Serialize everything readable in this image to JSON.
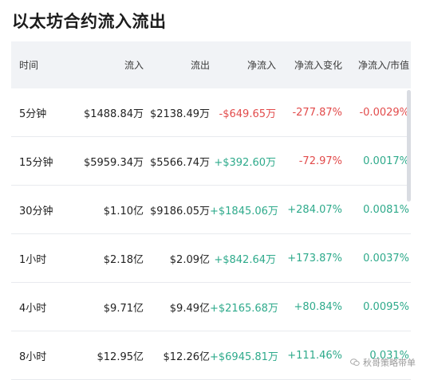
{
  "title": "以太坊合约流入流出",
  "columns": [
    "时间",
    "流入",
    "流出",
    "净流入",
    "净流入变化",
    "净流入/市值"
  ],
  "rows": [
    {
      "time": "5分钟",
      "inflow": "$1488.84万",
      "outflow": "$2138.49万",
      "net": "-$649.65万",
      "change": "-277.87%",
      "ratio": "-0.0029%",
      "net_dir": "neg",
      "change_dir": "neg",
      "ratio_dir": "neg"
    },
    {
      "time": "15分钟",
      "inflow": "$5959.34万",
      "outflow": "$5566.74万",
      "net": "+$392.60万",
      "change": "-72.97%",
      "ratio": "0.0017%",
      "net_dir": "pos",
      "change_dir": "neg",
      "ratio_dir": "pos"
    },
    {
      "time": "30分钟",
      "inflow": "$1.10亿",
      "outflow": "$9186.05万",
      "net": "+$1845.06万",
      "change": "+284.07%",
      "ratio": "0.0081%",
      "net_dir": "pos",
      "change_dir": "pos",
      "ratio_dir": "pos"
    },
    {
      "time": "1小时",
      "inflow": "$2.18亿",
      "outflow": "$2.09亿",
      "net": "+$842.64万",
      "change": "+173.87%",
      "ratio": "0.0037%",
      "net_dir": "pos",
      "change_dir": "pos",
      "ratio_dir": "pos"
    },
    {
      "time": "4小时",
      "inflow": "$9.71亿",
      "outflow": "$9.49亿",
      "net": "+$2165.68万",
      "change": "+80.84%",
      "ratio": "0.0095%",
      "net_dir": "pos",
      "change_dir": "pos",
      "ratio_dir": "pos"
    },
    {
      "time": "8小时",
      "inflow": "$12.95亿",
      "outflow": "$12.26亿",
      "net": "+$6945.81万",
      "change": "+111.46%",
      "ratio": "0.031%",
      "net_dir": "pos",
      "change_dir": "pos",
      "ratio_dir": "pos"
    }
  ],
  "colors": {
    "negative": "#e24b4b",
    "positive": "#2eaa8b",
    "header_bg": "#f1f3f6"
  },
  "watermark": {
    "icon": "wechat-icon",
    "text": "秋哥策略带单"
  }
}
